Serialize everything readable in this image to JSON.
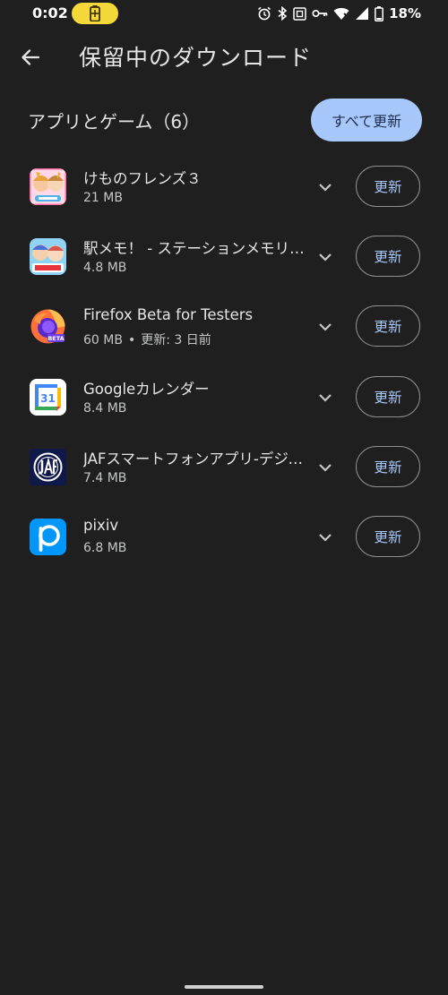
{
  "status_bar": {
    "time": "0:02",
    "battery_percent": "18%",
    "icons": [
      "alarm-icon",
      "bluetooth-icon",
      "nfc-icon",
      "vpn-key-icon",
      "wifi-icon",
      "signal-icon",
      "battery-icon"
    ],
    "battery_saver_color": "#f5d93b"
  },
  "app_bar": {
    "title": "保留中のダウンロード",
    "back_icon": "arrow-back-icon"
  },
  "section": {
    "title": "アプリとゲーム（6）",
    "update_all_label": "すべて更新",
    "accent_color": "#a8c7fa"
  },
  "apps": [
    {
      "name": "けものフレンズ３",
      "size": "21 MB",
      "extra": "",
      "update_label": "更新",
      "icon": "kemono-friends-icon"
    },
    {
      "name": "駅メモ！ - ステーションメモリーズ！",
      "size": "4.8 MB",
      "extra": "",
      "update_label": "更新",
      "icon": "ekimemo-icon"
    },
    {
      "name": "Firefox Beta for Testers",
      "size": "60 MB",
      "extra": "更新: 3 日前",
      "update_label": "更新",
      "icon": "firefox-beta-icon"
    },
    {
      "name": "Googleカレンダー",
      "size": "8.4 MB",
      "extra": "",
      "update_label": "更新",
      "icon": "google-calendar-icon"
    },
    {
      "name": "JAFスマートフォンアプリ-デジタル会員証",
      "size": "7.4 MB",
      "extra": "",
      "update_label": "更新",
      "icon": "jaf-icon"
    },
    {
      "name": "pixiv",
      "size": "6.8 MB",
      "extra": "",
      "update_label": "更新",
      "icon": "pixiv-icon"
    }
  ]
}
